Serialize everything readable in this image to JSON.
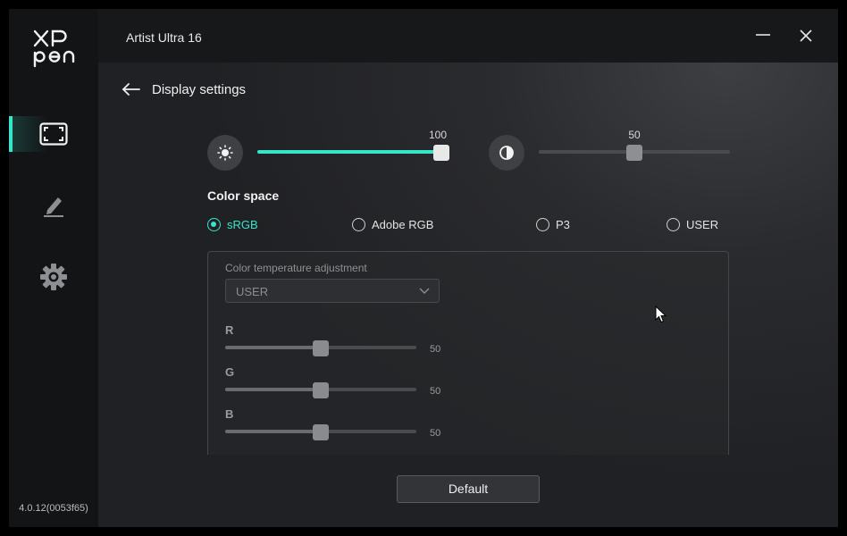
{
  "brand": {
    "logo_top": "XP",
    "logo_bottom": "pen"
  },
  "app": {
    "title": "Artist Ultra 16",
    "version": "4.0.12(0053f65)"
  },
  "sidebar": {
    "items": [
      {
        "id": "display",
        "icon": "display-frame-icon",
        "active": true
      },
      {
        "id": "pen",
        "icon": "pen-icon",
        "active": false
      },
      {
        "id": "settings",
        "icon": "gear-icon",
        "active": false
      }
    ]
  },
  "page": {
    "title": "Display settings"
  },
  "brightness": {
    "icon": "brightness-icon",
    "value": "100",
    "level": 1.0
  },
  "contrast": {
    "icon": "contrast-icon",
    "value": "50",
    "level": 0.5
  },
  "color_space": {
    "title": "Color space",
    "options": [
      {
        "label": "sRGB",
        "checked": true
      },
      {
        "label": "Adobe RGB",
        "checked": false
      },
      {
        "label": "P3",
        "checked": false
      },
      {
        "label": "USER",
        "checked": false
      }
    ]
  },
  "temperature": {
    "label": "Color temperature adjustment",
    "selected": "USER"
  },
  "channels": [
    {
      "label": "R",
      "value": "50",
      "level": 0.5
    },
    {
      "label": "G",
      "value": "50",
      "level": 0.5
    },
    {
      "label": "B",
      "value": "50",
      "level": 0.5
    }
  ],
  "actions": {
    "default_label": "Default"
  },
  "colors": {
    "accent": "#37e5c9",
    "thumb_active": "#e8e8e8",
    "thumb_disabled": "#8a8b8e"
  }
}
